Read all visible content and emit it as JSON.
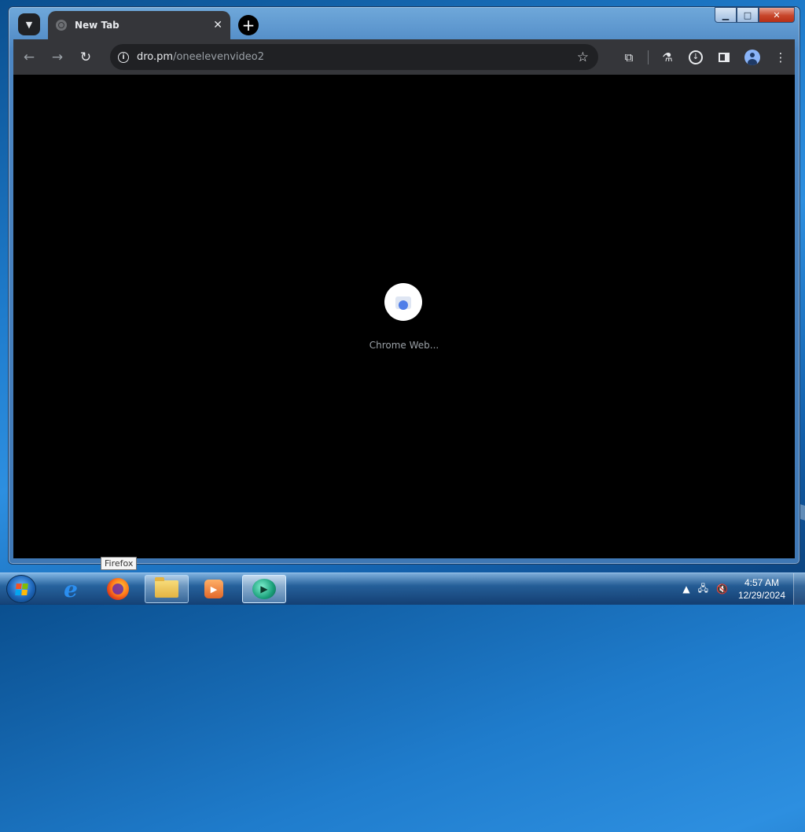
{
  "browser": {
    "tab": {
      "title": "New Tab",
      "close_glyph": "✕"
    },
    "new_tab_glyph": "+",
    "address": {
      "host": "dro.pm",
      "path": "/oneelevenvideo2"
    },
    "nav": {
      "back_glyph": "←",
      "forward_glyph": "→",
      "reload_glyph": "↻"
    },
    "window_controls": {
      "minimize": "▁",
      "maximize": "□",
      "close": "✕"
    }
  },
  "page": {
    "loading_label": "Chrome Web..."
  },
  "taskbar": {
    "tooltip": "Firefox",
    "apps": [
      "internet-explorer",
      "firefox",
      "file-explorer",
      "media-player",
      "custom-app"
    ],
    "clock": {
      "time": "4:57 AM",
      "date": "12/29/2024"
    }
  },
  "colors": {
    "chrome_toolbar": "#35363a",
    "omnibox": "#202124",
    "page_bg": "#000000"
  }
}
